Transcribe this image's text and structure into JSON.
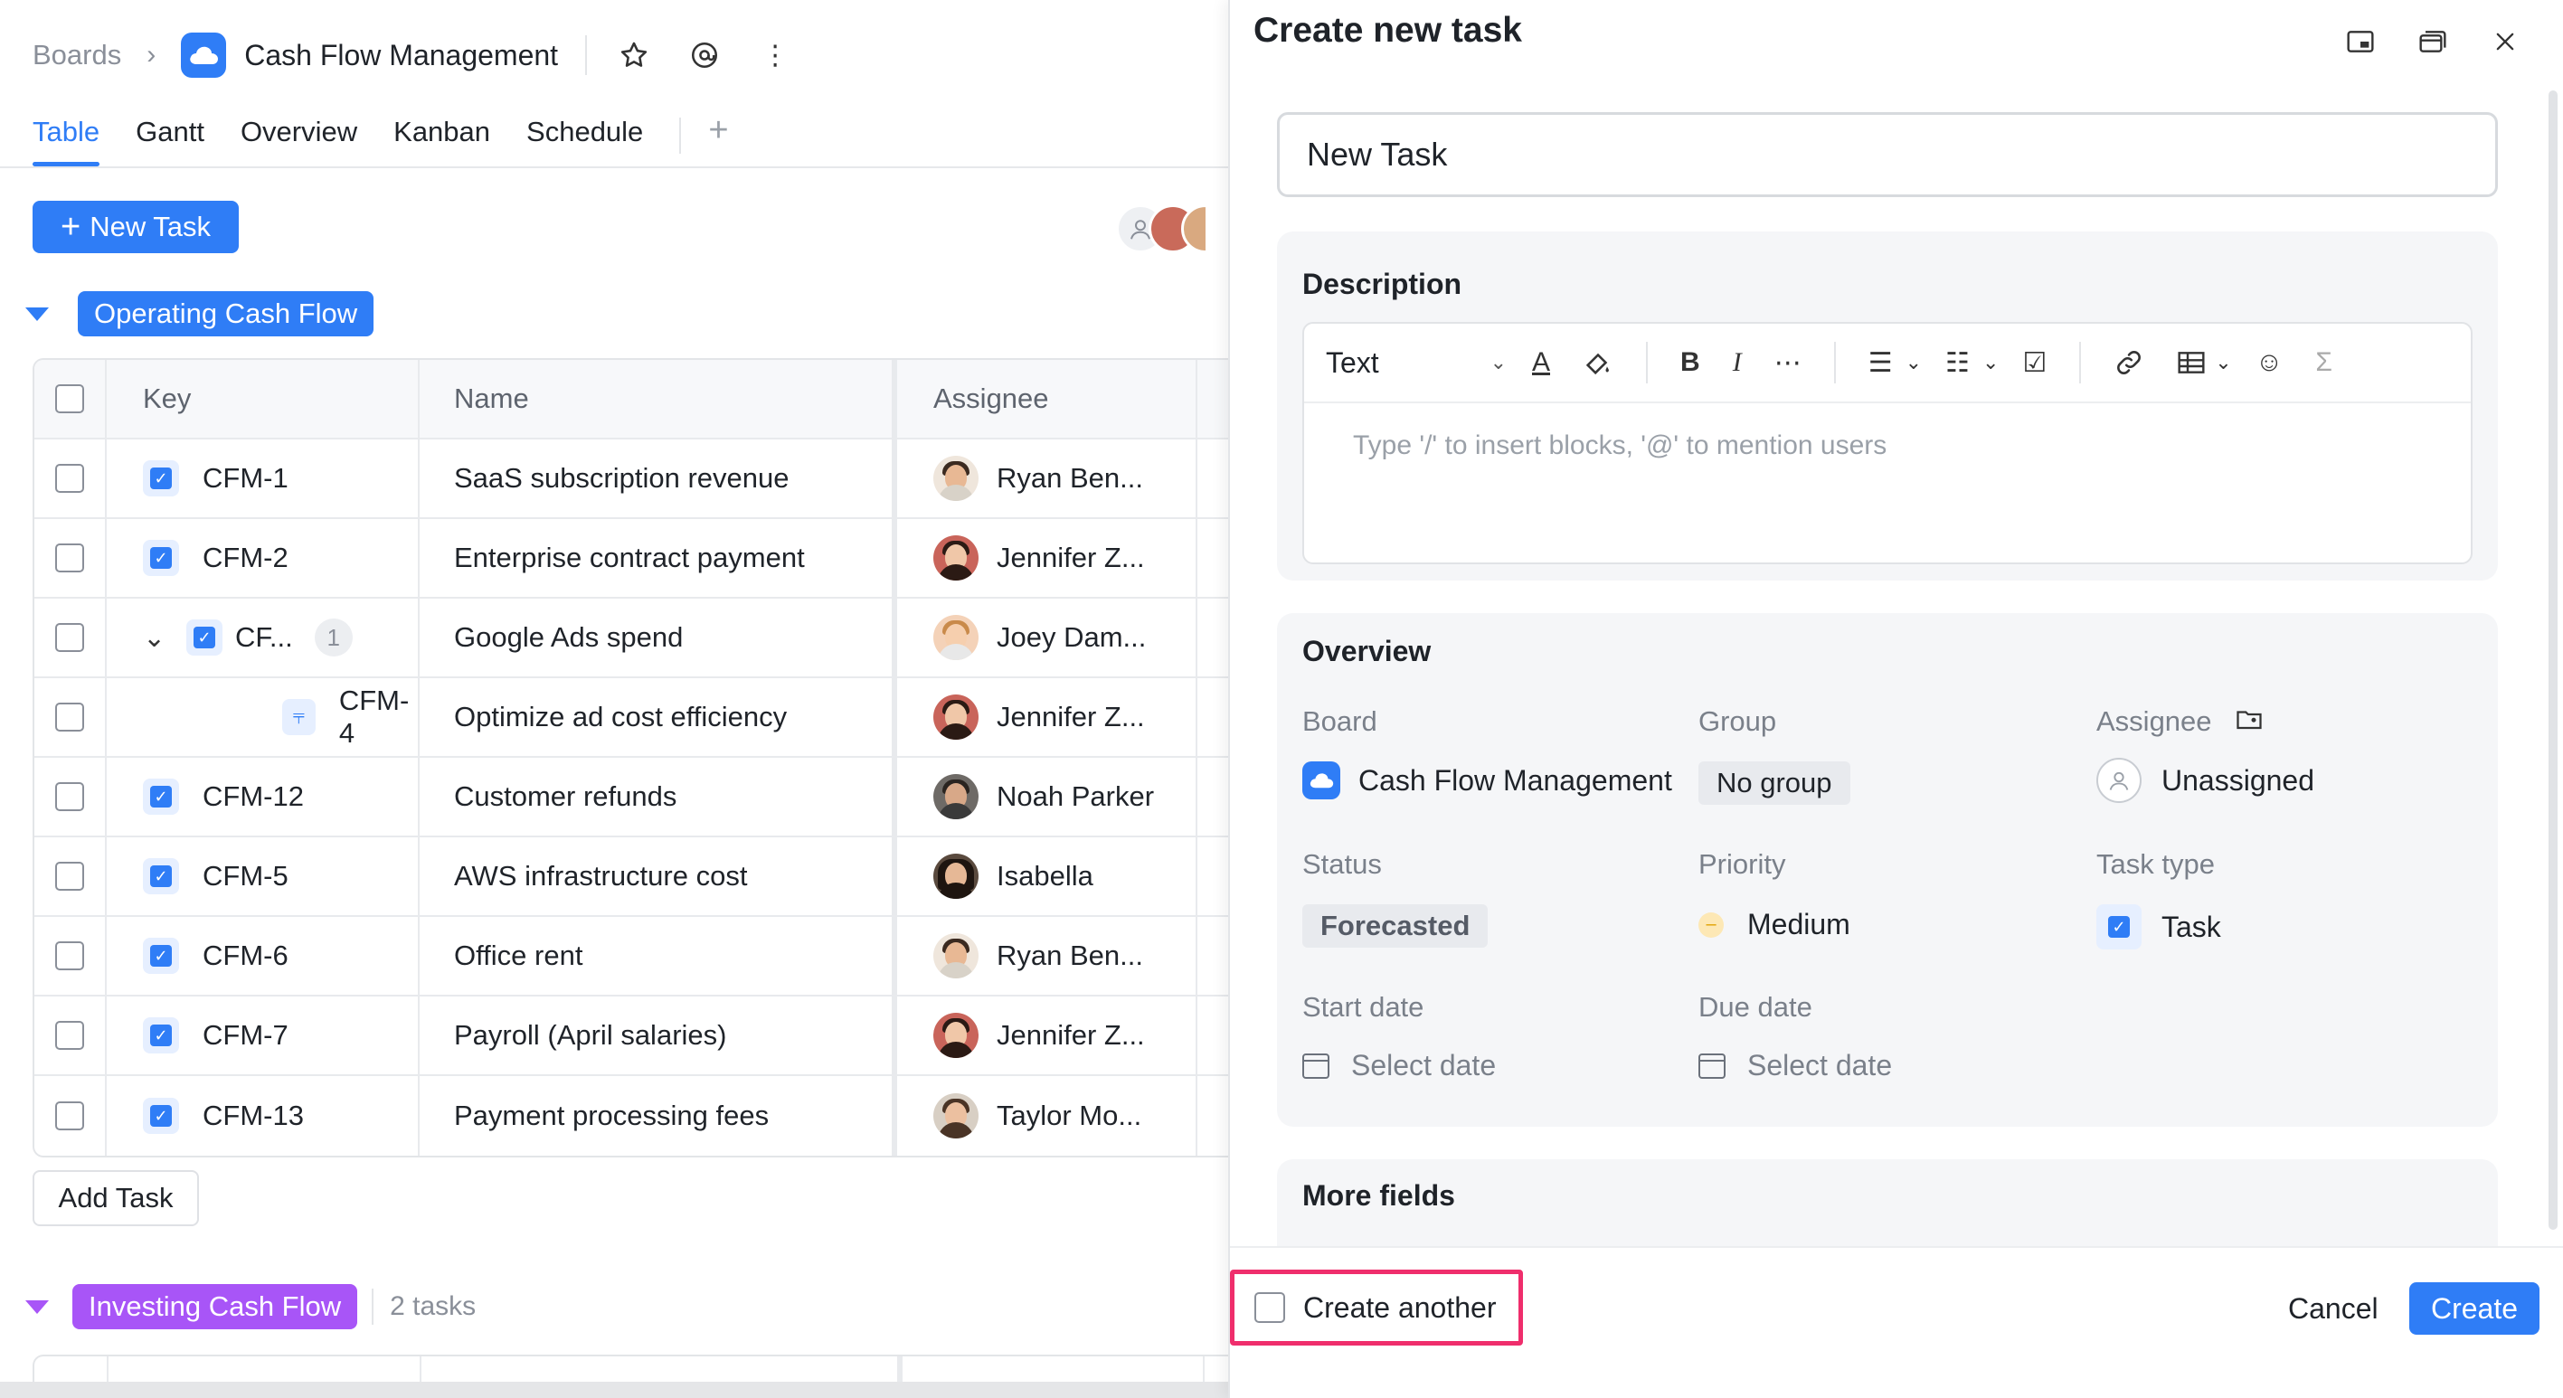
{
  "breadcrumb": {
    "root": "Boards",
    "separator": ">",
    "board": "Cash Flow Management"
  },
  "tabs": [
    {
      "label": "Table",
      "active": true
    },
    {
      "label": "Gantt",
      "active": false
    },
    {
      "label": "Overview",
      "active": false
    },
    {
      "label": "Kanban",
      "active": false
    },
    {
      "label": "Schedule",
      "active": false
    }
  ],
  "toolbar": {
    "new_task_label": "New Task",
    "add_tab_symbol": "+"
  },
  "groups": {
    "operating": {
      "label": "Operating Cash Flow",
      "color": "#2f7df6"
    },
    "investing": {
      "label": "Investing Cash Flow",
      "count": "2 tasks",
      "color": "#a855f7"
    }
  },
  "table": {
    "columns": {
      "key": "Key",
      "name": "Name",
      "assignee": "Assignee"
    },
    "rows": [
      {
        "key": "CFM-1",
        "name": "SaaS subscription revenue",
        "assignee": "Ryan Ben..."
      },
      {
        "key": "CFM-2",
        "name": "Enterprise contract payment",
        "assignee": "Jennifer Z..."
      },
      {
        "key": "CF...",
        "name": "Google Ads spend",
        "assignee": "Joey Dam...",
        "subtasks": "1"
      },
      {
        "key": "CFM-4",
        "name": "Optimize ad cost efficiency",
        "assignee": "Jennifer Z..."
      },
      {
        "key": "CFM-12",
        "name": "Customer refunds",
        "assignee": "Noah Parker"
      },
      {
        "key": "CFM-5",
        "name": "AWS infrastructure cost",
        "assignee": "Isabella"
      },
      {
        "key": "CFM-6",
        "name": "Office rent",
        "assignee": "Ryan Ben..."
      },
      {
        "key": "CFM-7",
        "name": "Payroll (April salaries)",
        "assignee": "Jennifer Z..."
      },
      {
        "key": "CFM-13",
        "name": "Payment processing fees",
        "assignee": "Taylor Mo..."
      }
    ],
    "add_task_label": "Add Task"
  },
  "panel": {
    "title": "Create new task",
    "title_value": "New Task",
    "description": {
      "heading": "Description",
      "text_style": "Text",
      "placeholder": "Type '/' to insert blocks, '@' to mention users"
    },
    "overview": {
      "heading": "Overview",
      "board_label": "Board",
      "board_value": "Cash Flow Management",
      "group_label": "Group",
      "group_value": "No group",
      "assignee_label": "Assignee",
      "assignee_value": "Unassigned",
      "status_label": "Status",
      "status_value": "Forecasted",
      "priority_label": "Priority",
      "priority_value": "Medium",
      "tasktype_label": "Task type",
      "tasktype_value": "Task",
      "start_label": "Start date",
      "start_value": "Select date",
      "due_label": "Due date",
      "due_value": "Select date"
    },
    "more_fields": "More fields",
    "footer": {
      "create_another": "Create another",
      "cancel": "Cancel",
      "create": "Create"
    }
  }
}
